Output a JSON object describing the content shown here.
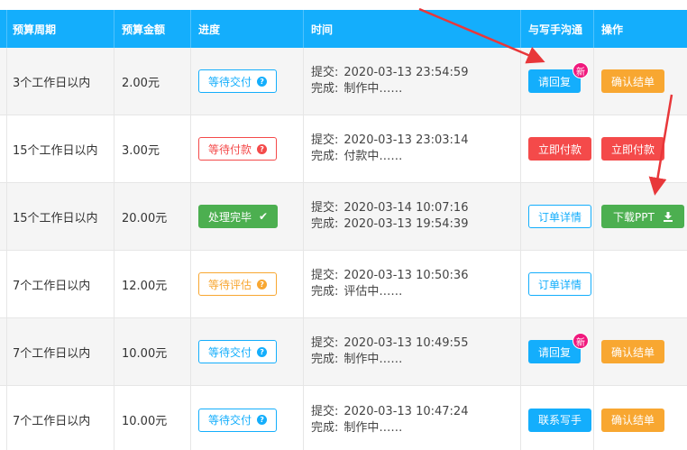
{
  "header": {
    "cycle": "预算周期",
    "amount": "预算金额",
    "progress": "进度",
    "time": "时间",
    "communicate": "与写手沟通",
    "action": "操作"
  },
  "labels": {
    "submit": "提交:",
    "finish": "完成:"
  },
  "rows": [
    {
      "cycle": "3个工作日以内",
      "amount": "2.00元",
      "status": "等待交付",
      "submit_time": "2020-03-13 23:54:59",
      "finish_text": "制作中……",
      "communicate": "请回复",
      "communicate_badge": "新",
      "action": "确认结单"
    },
    {
      "cycle": "15个工作日以内",
      "amount": "3.00元",
      "status": "等待付款",
      "submit_time": "2020-03-13 23:03:14",
      "finish_text": "付款中……",
      "communicate": "立即付款",
      "action": "立即付款"
    },
    {
      "cycle": "15个工作日以内",
      "amount": "20.00元",
      "status": "处理完毕",
      "submit_time": "2020-03-14 10:07:16",
      "finish_text": "2020-03-13 19:54:39",
      "communicate": "订单详情",
      "action": "下载PPT"
    },
    {
      "cycle": "7个工作日以内",
      "amount": "12.00元",
      "status": "等待评估",
      "submit_time": "2020-03-13 10:50:36",
      "finish_text": "评估中……",
      "communicate": "订单详情"
    },
    {
      "cycle": "7个工作日以内",
      "amount": "10.00元",
      "status": "等待交付",
      "submit_time": "2020-03-13 10:49:55",
      "finish_text": "制作中……",
      "communicate": "请回复",
      "communicate_badge": "新",
      "action": "确认结单"
    },
    {
      "cycle": "7个工作日以内",
      "amount": "10.00元",
      "status": "等待交付",
      "submit_time": "2020-03-13 10:47:24",
      "finish_text": "制作中……",
      "communicate": "联系写手",
      "action": "确认结单"
    }
  ],
  "colors": {
    "header": "#14aefc",
    "blue": "#14aefc",
    "red": "#f44a4a",
    "orange": "#f8a731",
    "green": "#4caf50",
    "badge": "#f0197d",
    "arrow": "#e8373a"
  }
}
